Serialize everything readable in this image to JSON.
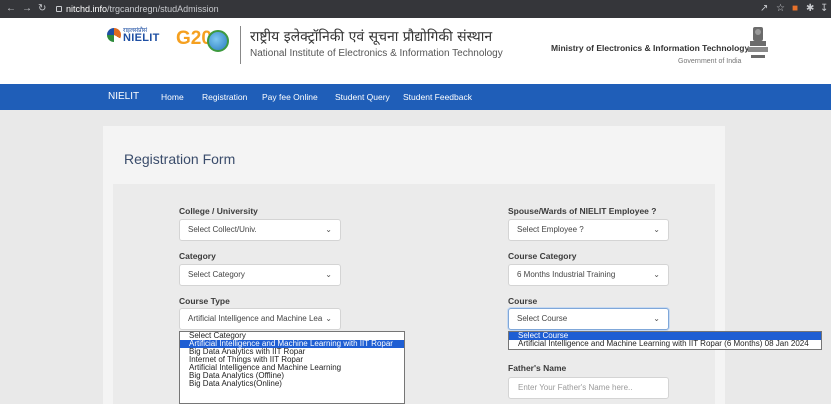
{
  "browser": {
    "url_host": "nitchd.info",
    "url_path": "/trgcandregn/studAdmission"
  },
  "header": {
    "logo_hindi": "राइलसंप्रौसं",
    "logo_text": "NIELIT",
    "g20": "G20",
    "institute_hindi": "राष्ट्रीय इलेक्ट्रॉनिकी एवं सूचना प्रौद्योगिकी संस्थान",
    "institute_english": "National Institute of Electronics & Information Technology",
    "ministry": "Ministry of Electronics & Information Technology",
    "government": "Government of India"
  },
  "nav": {
    "brand": "NIELIT",
    "items": [
      "Home",
      "Registration",
      "Pay fee Online",
      "Student Query",
      "Student Feedback"
    ]
  },
  "form": {
    "title": "Registration Form",
    "college_label": "College / University",
    "college_value": "Select Collect/Univ.",
    "spouse_label": "Spouse/Wards of NIELIT Employee ?",
    "spouse_value": "Select Employee ?",
    "category_label": "Category",
    "category_value": "Select Category",
    "course_category_label": "Course Category",
    "course_category_value": "6 Months Industrial Training",
    "course_type_label": "Course Type",
    "course_type_value": "Artificial Intelligence and Machine Lea",
    "course_label": "Course",
    "course_value": "Select Course",
    "father_label": "Father's Name",
    "father_placeholder": "Enter Your Father's Name here..",
    "course_type_options": [
      "Select Category",
      "Artificial Intelligence and Machine Learning with IIT Ropar",
      "Big Data Analytics with IIT Ropar",
      "Internet of Things with IIT Ropar",
      "Artificial Intelligence and Machine Learning",
      "Big Data Analytics (Offline)",
      "Big Data Analytics(Online)"
    ],
    "course_type_selected_index": 1,
    "course_options": [
      "Select Course",
      "Artificial Intelligence and Machine Learning with IIT Ropar (6 Months) 08 Jan 2024"
    ],
    "course_selected_index": 0
  },
  "icons": {
    "back": "arrow-left-icon",
    "forward": "arrow-right-icon",
    "reload": "reload-icon",
    "chevron": "chevron-down-icon"
  },
  "colors": {
    "navbar": "#1f5eb8",
    "dropdown_highlight": "#1e5ed3",
    "chrome": "#35363a"
  }
}
